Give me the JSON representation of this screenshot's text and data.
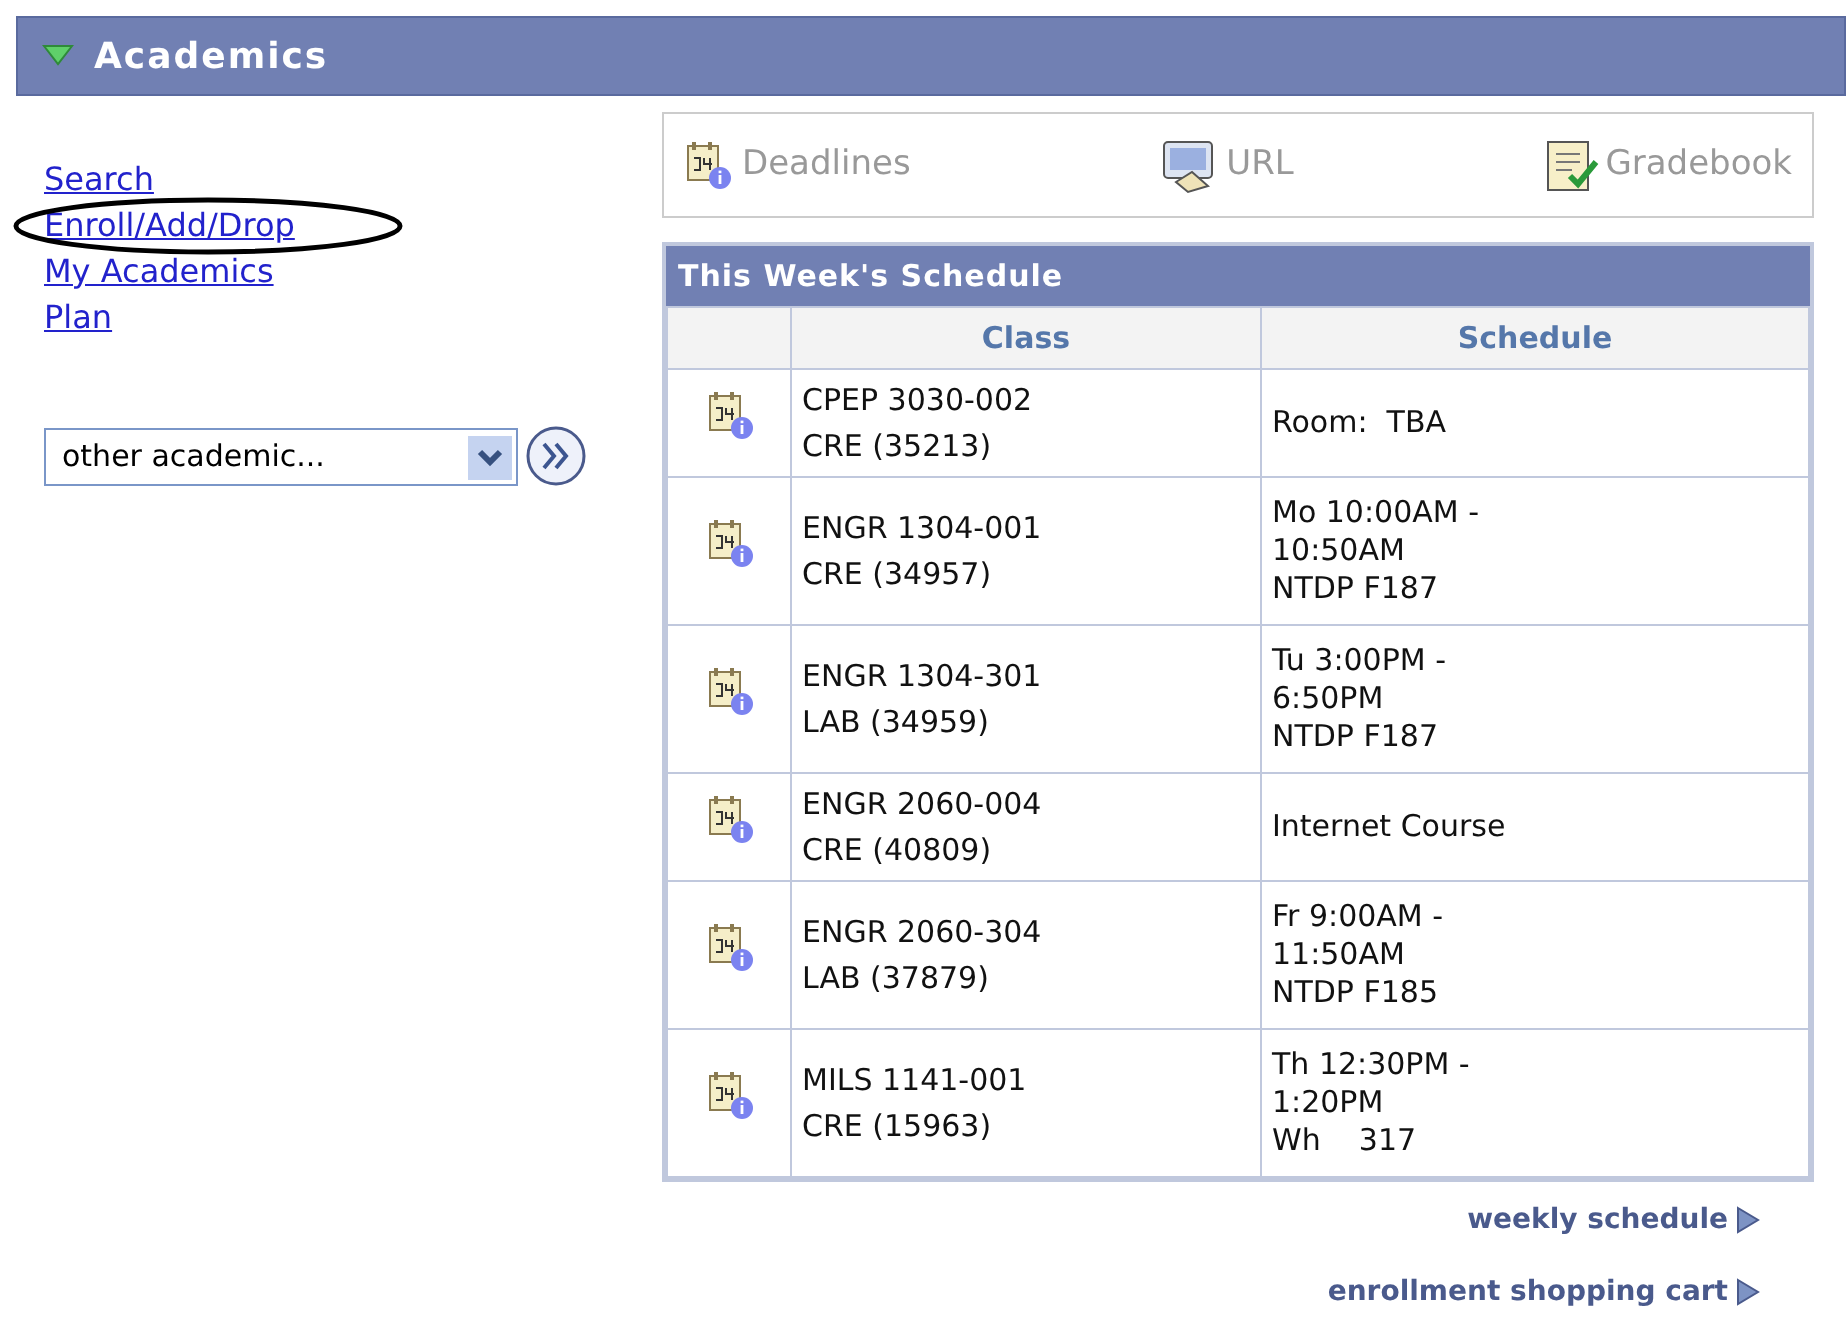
{
  "panel": {
    "title": "Academics",
    "expanded": true
  },
  "links": [
    {
      "label": "Search",
      "circled": false
    },
    {
      "label": "Enroll/Add/Drop",
      "circled": true
    },
    {
      "label": "My Academics",
      "circled": false
    },
    {
      "label": "Plan",
      "circled": false
    }
  ],
  "dropdown": {
    "value": "other academic..."
  },
  "toolbar": [
    {
      "kind": "deadlines",
      "label": "Deadlines"
    },
    {
      "kind": "url",
      "label": "URL"
    },
    {
      "kind": "gradebook",
      "label": "Gradebook"
    }
  ],
  "schedule": {
    "title": "This Week's Schedule",
    "columns": [
      "Class",
      "Schedule"
    ],
    "rows": [
      {
        "class": [
          "CPEP 3030-002",
          "CRE (35213)"
        ],
        "schedule": [
          "Room:  TBA"
        ]
      },
      {
        "class": [
          "ENGR 1304-001",
          "CRE (34957)"
        ],
        "schedule": [
          "Mo 10:00AM -",
          "10:50AM",
          "NTDP F187"
        ]
      },
      {
        "class": [
          "ENGR 1304-301",
          "LAB (34959)"
        ],
        "schedule": [
          "Tu 3:00PM -",
          "6:50PM",
          "NTDP F187"
        ]
      },
      {
        "class": [
          "ENGR 2060-004",
          "CRE (40809)"
        ],
        "schedule": [
          "Internet Course"
        ]
      },
      {
        "class": [
          "ENGR 2060-304",
          "LAB (37879)"
        ],
        "schedule": [
          "Fr 9:00AM -",
          "11:50AM",
          "NTDP F185"
        ]
      },
      {
        "class": [
          "MILS 1141-001",
          "CRE (15963)"
        ],
        "schedule": [
          "Th 12:30PM -",
          "1:20PM",
          "Wh    317"
        ]
      }
    ]
  },
  "footer_links": [
    "weekly schedule",
    "enrollment shopping cart"
  ]
}
